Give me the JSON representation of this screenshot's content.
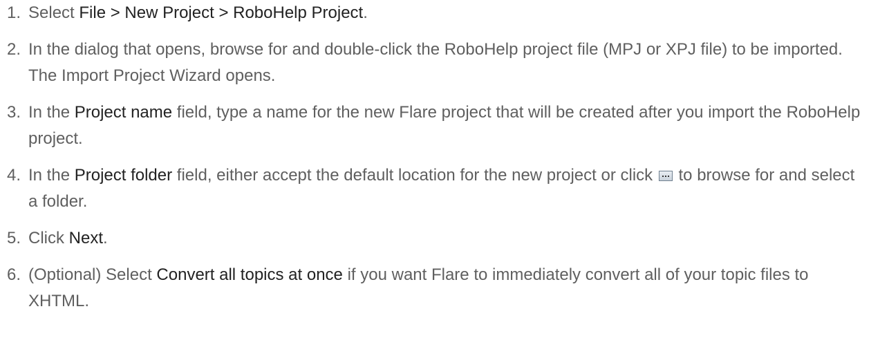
{
  "steps": [
    {
      "number": "1.",
      "parts": [
        {
          "text": "Select "
        },
        {
          "text": "File > New Project > RoboHelp Project",
          "bold": true
        },
        {
          "text": "."
        }
      ]
    },
    {
      "number": "2.",
      "parts": [
        {
          "text": "In the dialog that opens, browse for and double-click the RoboHelp project file (MPJ or XPJ file) to be imported. The Import Project Wizard opens."
        }
      ]
    },
    {
      "number": "3.",
      "parts": [
        {
          "text": "In the "
        },
        {
          "text": "Project name",
          "bold": true
        },
        {
          "text": " field, type a name for the new Flare project that will be created after you import the RoboHelp project."
        }
      ]
    },
    {
      "number": "4.",
      "parts": [
        {
          "text": "In the "
        },
        {
          "text": "Project folder",
          "bold": true
        },
        {
          "text": " field, either accept the default location for the new project or click "
        },
        {
          "icon": "browse-ellipsis-icon"
        },
        {
          "text": " to browse for and select a folder."
        }
      ]
    },
    {
      "number": "5.",
      "parts": [
        {
          "text": "Click "
        },
        {
          "text": "Next",
          "bold": true
        },
        {
          "text": "."
        }
      ]
    },
    {
      "number": "6.",
      "parts": [
        {
          "text": "(Optional) Select "
        },
        {
          "text": "Convert all topics at once",
          "bold": true
        },
        {
          "text": " if you want Flare to immediately convert all of your topic files to XHTML."
        }
      ]
    }
  ]
}
